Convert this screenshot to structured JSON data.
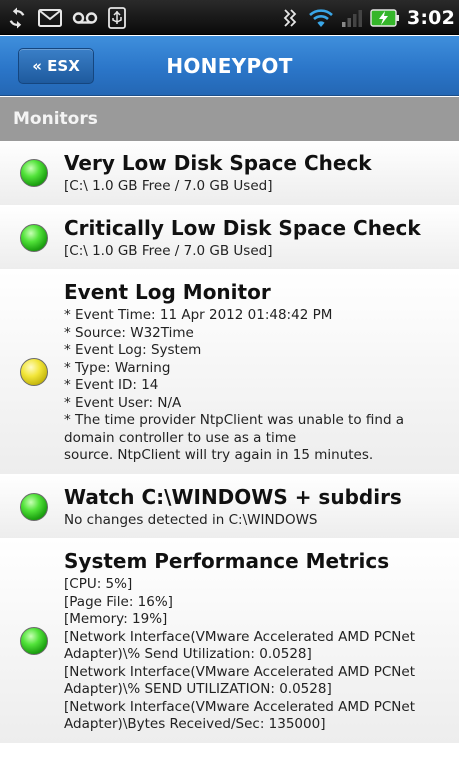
{
  "status_bar": {
    "time": "3:02",
    "icons": [
      "sync-icon",
      "gmail-icon",
      "voicemail-icon",
      "usb-icon",
      "vibrate-icon",
      "wifi-icon",
      "signal-icon",
      "battery-charging-icon"
    ]
  },
  "header": {
    "back_label": "« ESX",
    "title": "HONEYPOT"
  },
  "section": {
    "title": "Monitors"
  },
  "monitors": [
    {
      "status": "green",
      "title": "Very Low Disk Space Check",
      "detail": "[C:\\ 1.0 GB Free / 7.0 GB Used]"
    },
    {
      "status": "green",
      "title": "Critically Low Disk Space Check",
      "detail": "[C:\\ 1.0 GB Free / 7.0 GB Used]"
    },
    {
      "status": "yellow",
      "title": "Event Log Monitor",
      "detail": "* Event Time: 11 Apr 2012 01:48:42 PM\n* Source: W32Time\n* Event Log: System\n* Type: Warning\n* Event ID: 14\n* Event User: N/A\n* The time provider NtpClient was unable to find a domain controller to use as a time\nsource. NtpClient will try again in 15 minutes."
    },
    {
      "status": "green",
      "title": "Watch C:\\WINDOWS + subdirs",
      "detail": "No changes detected in C:\\WINDOWS"
    },
    {
      "status": "green",
      "title": "System Performance Metrics",
      "detail": "[CPU: 5%]\n[Page File: 16%]\n[Memory: 19%]\n[Network Interface(VMware Accelerated AMD PCNet Adapter)\\% Send Utilization: 0.0528]\n[Network Interface(VMware Accelerated AMD PCNet Adapter)\\% SEND UTILIZATION: 0.0528]\n[Network Interface(VMware Accelerated AMD PCNet Adapter)\\Bytes Received/Sec: 135000]"
    }
  ],
  "colors": {
    "title_bar": "#2b76c9",
    "section_header": "#9a9a9a",
    "status_green": "#1ea312",
    "status_yellow": "#c8ba10"
  }
}
